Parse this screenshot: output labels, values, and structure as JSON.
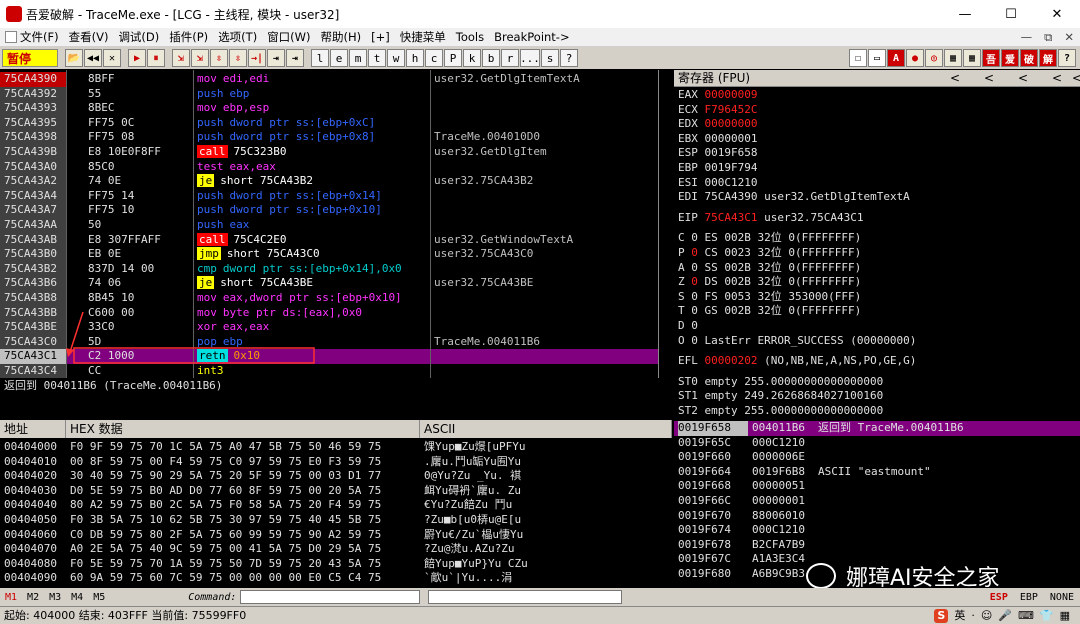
{
  "window": {
    "title": "吾爱破解 - TraceMe.exe - [LCG - 主线程, 模块 - user32]",
    "controls": {
      "min": "—",
      "max": "☐",
      "close": "✕"
    }
  },
  "menu": {
    "items": [
      "文件(F)",
      "查看(V)",
      "调试(D)",
      "插件(P)",
      "选项(T)",
      "窗口(W)",
      "帮助(H)",
      "[+]",
      "快捷菜单",
      "Tools",
      "BreakPoint->"
    ],
    "right": [
      "—",
      "⧉",
      "✕"
    ]
  },
  "toolbar": {
    "status": "暂停",
    "buttons": [
      "📂",
      "◀◀",
      "✕",
      "▶",
      "⏸",
      "⇲",
      "⇲",
      "⇳",
      "⇳",
      "→|",
      "⇥",
      "⇥"
    ],
    "letters": [
      "l",
      "e",
      "m",
      "t",
      "w",
      "h",
      "c",
      "P",
      "k",
      "b",
      "r",
      "...",
      "s",
      "?"
    ],
    "right_buttons": [
      "☐",
      "▭",
      "A",
      "●",
      "◎",
      "▦",
      "▦",
      "吾",
      "爱",
      "破",
      "解",
      "?"
    ]
  },
  "disasm": {
    "rows": [
      {
        "addr": "75CA4390",
        "hex": "8BFF",
        "op": "mov",
        "ops": "edi,edi",
        "cmt": "user32.GetDlgItemTextA",
        "cls": "kw-mov",
        "sel": true
      },
      {
        "addr": "75CA4392",
        "hex": "55",
        "op": "push",
        "ops": "ebp",
        "cmt": "",
        "cls": "kw-push"
      },
      {
        "addr": "75CA4393",
        "hex": "8BEC",
        "op": "mov",
        "ops": "ebp,esp",
        "cmt": "",
        "cls": "kw-mov"
      },
      {
        "addr": "75CA4395",
        "hex": "FF75 0C",
        "op": "push",
        "ops": "dword ptr ss:[ebp+0xC]",
        "cmt": "",
        "cls": "kw-push"
      },
      {
        "addr": "75CA4398",
        "hex": "FF75 08",
        "op": "push",
        "ops": "dword ptr ss:[ebp+0x8]",
        "cmt": "TraceMe.004010D0",
        "cls": "kw-push"
      },
      {
        "addr": "75CA439B",
        "hex": "E8 10E0F8FF",
        "op": "call",
        "ops": "75C323B0",
        "cmt": "user32.GetDlgItem",
        "cls": "kw-call"
      },
      {
        "addr": "75CA43A0",
        "hex": "85C0",
        "op": "test",
        "ops": "eax,eax",
        "cmt": "",
        "cls": "kw-test"
      },
      {
        "addr": "75CA43A2",
        "hex": "74 0E",
        "op": "je",
        "ops": "short 75CA43B2",
        "cmt": "user32.75CA43B2",
        "cls": "kw-je"
      },
      {
        "addr": "75CA43A4",
        "hex": "FF75 14",
        "op": "push",
        "ops": "dword ptr ss:[ebp+0x14]",
        "cmt": "",
        "cls": "kw-push"
      },
      {
        "addr": "75CA43A7",
        "hex": "FF75 10",
        "op": "push",
        "ops": "dword ptr ss:[ebp+0x10]",
        "cmt": "",
        "cls": "kw-push"
      },
      {
        "addr": "75CA43AA",
        "hex": "50",
        "op": "push",
        "ops": "eax",
        "cmt": "",
        "cls": "kw-push"
      },
      {
        "addr": "75CA43AB",
        "hex": "E8 307FFAFF",
        "op": "call",
        "ops": "75C4C2E0",
        "cmt": "user32.GetWindowTextA",
        "cls": "kw-call"
      },
      {
        "addr": "75CA43B0",
        "hex": "EB 0E",
        "op": "jmp",
        "ops": "short 75CA43C0",
        "cmt": "user32.75CA43C0",
        "cls": "kw-je"
      },
      {
        "addr": "75CA43B2",
        "hex": "837D 14 00",
        "op": "cmp",
        "ops": "dword ptr ss:[ebp+0x14],0x0",
        "cmt": "",
        "cls": "kw-cmp"
      },
      {
        "addr": "75CA43B6",
        "hex": "74 06",
        "op": "je",
        "ops": "short 75CA43BE",
        "cmt": "user32.75CA43BE",
        "cls": "kw-je"
      },
      {
        "addr": "75CA43B8",
        "hex": "8B45 10",
        "op": "mov",
        "ops": "eax,dword ptr ss:[ebp+0x10]",
        "cmt": "",
        "cls": "kw-mov"
      },
      {
        "addr": "75CA43BB",
        "hex": "C600 00",
        "op": "mov",
        "ops": "byte ptr ds:[eax],0x0",
        "cmt": "",
        "cls": "kw-mov"
      },
      {
        "addr": "75CA43BE",
        "hex": "33C0",
        "op": "xor",
        "ops": "eax,eax",
        "cmt": "",
        "cls": "kw-xor"
      },
      {
        "addr": "75CA43C0",
        "hex": "5D",
        "op": "pop",
        "ops": "ebp",
        "cmt": "TraceMe.004011B6",
        "cls": "kw-pop"
      },
      {
        "addr": "75CA43C1",
        "hex": "C2 1000",
        "op": "retn",
        "ops": "0x10",
        "cmt": "",
        "cls": "kw-retn",
        "hl": true
      },
      {
        "addr": "75CA43C4",
        "hex": "CC",
        "op": "int3",
        "ops": "",
        "cmt": "",
        "cls": "kw-int"
      }
    ],
    "info": "返回到 004011B6 (TraceMe.004011B6)"
  },
  "registers": {
    "header": "寄存器 (FPU)",
    "arrows": [
      "<",
      "<",
      "<",
      "<",
      "<"
    ],
    "gp": [
      {
        "name": "EAX",
        "val": "00000009",
        "red": true,
        "extra": ""
      },
      {
        "name": "ECX",
        "val": "F796452C",
        "red": true,
        "extra": ""
      },
      {
        "name": "EDX",
        "val": "00000000",
        "red": true,
        "extra": ""
      },
      {
        "name": "EBX",
        "val": "00000001",
        "red": false,
        "extra": ""
      },
      {
        "name": "ESP",
        "val": "0019F658",
        "red": false,
        "extra": ""
      },
      {
        "name": "EBP",
        "val": "0019F794",
        "red": false,
        "extra": ""
      },
      {
        "name": "ESI",
        "val": "000C1210",
        "red": false,
        "extra": ""
      },
      {
        "name": "EDI",
        "val": "75CA4390",
        "red": false,
        "extra": "user32.GetDlgItemTextA"
      }
    ],
    "eip": {
      "name": "EIP",
      "val": "75CA43C1",
      "extra": "user32.75CA43C1"
    },
    "flags": [
      {
        "f": "C",
        "v": "0",
        "seg": "ES",
        "sv": "002B",
        "bits": "32位",
        "lim": "0(FFFFFFFF)"
      },
      {
        "f": "P",
        "v": "0",
        "seg": "CS",
        "sv": "0023",
        "bits": "32位",
        "lim": "0(FFFFFFFF)",
        "red": true
      },
      {
        "f": "A",
        "v": "0",
        "seg": "SS",
        "sv": "002B",
        "bits": "32位",
        "lim": "0(FFFFFFFF)"
      },
      {
        "f": "Z",
        "v": "0",
        "seg": "DS",
        "sv": "002B",
        "bits": "32位",
        "lim": "0(FFFFFFFF)",
        "red": true
      },
      {
        "f": "S",
        "v": "0",
        "seg": "FS",
        "sv": "0053",
        "bits": "32位",
        "lim": "353000(FFF)"
      },
      {
        "f": "T",
        "v": "0",
        "seg": "GS",
        "sv": "002B",
        "bits": "32位",
        "lim": "0(FFFFFFFF)"
      },
      {
        "f": "D",
        "v": "0",
        "seg": "",
        "sv": "",
        "bits": "",
        "lim": ""
      },
      {
        "f": "O",
        "v": "0",
        "seg": "LastErr",
        "sv": "ERROR_SUCCESS (00000000)",
        "bits": "",
        "lim": ""
      }
    ],
    "efl": {
      "name": "EFL",
      "val": "00000202",
      "extra": "(NO,NB,NE,A,NS,PO,GE,G)"
    },
    "st": [
      "ST0 empty 255.00000000000000000",
      "ST1 empty 249.26268684027100160",
      "ST2 empty 255.00000000000000000"
    ]
  },
  "dump": {
    "headers": [
      "地址",
      "HEX 数据",
      "ASCII"
    ],
    "rows": [
      {
        "addr": "00404000",
        "hex": "F0 9F 59 75 70 1C 5A 75 A0 47 5B 75 50 46 59 75",
        "ascii": "馃Yup■Zu燝[uPFYu"
      },
      {
        "addr": "00404010",
        "hex": "00 8F 59 75 00 F4 59 75 C0 97 59 75 E0 F3 59 75",
        "ascii": ".廜u.鬥u缿Yu囿Yu"
      },
      {
        "addr": "00404020",
        "hex": "30 40 59 75 90 29 5A 75 20 5F 59 75 00 03 D1 77",
        "ascii": "0@Yu?Zu _Yu. 褀"
      },
      {
        "addr": "00404030",
        "hex": "D0 5E 59 75 B0 AD D0 77 60 8F 59 75 00 20 5A 75",
        "ascii": "衈Yu碍袇`廜u. Zu"
      },
      {
        "addr": "00404040",
        "hex": "80 A2 59 75 B0 2C 5A 75 F0 58 5A 75 20 F4 59 75",
        "ascii": "€Yu?Zu餢Zu 鬥u"
      },
      {
        "addr": "00404050",
        "hex": "F0 3B 5A 75 10 62 5B 75 30 97 59 75 40 45 5B 75",
        "ascii": "?Zu■b[u0梇u@E[u"
      },
      {
        "addr": "00404060",
        "hex": "C0 DB 59 75 80 2F 5A 75 60 99 59 75 90 A2 59 75",
        "ascii": "罻Yu€/Zu`橸u悽Yu"
      },
      {
        "addr": "00404070",
        "hex": "A0 2E 5A 75 40 9C 59 75 00 41 5A 75 D0 29 5A 75",
        "ascii": "?Zu@滼u.AZu?Zu"
      },
      {
        "addr": "00404080",
        "hex": "F0 5E 59 75 70 1A 59 75 50 7D 59 75 20 43 5A 75",
        "ascii": "餢Yup■YuP}Yu CZu"
      },
      {
        "addr": "00404090",
        "hex": "60 9A 59 75 60 7C 59 75 00 00 00 00 E0 C5 C4 75",
        "ascii": "`歒u`|Yu....涓"
      }
    ]
  },
  "stack": {
    "rows": [
      {
        "addr": "0019F658",
        "val": "004011B6",
        "cmt": "返回到 TraceMe.004011B6",
        "sel": true
      },
      {
        "addr": "0019F65C",
        "val": "000C1210",
        "cmt": ""
      },
      {
        "addr": "0019F660",
        "val": "0000006E",
        "cmt": ""
      },
      {
        "addr": "0019F664",
        "val": "0019F6B8",
        "cmt": "ASCII \"eastmount\""
      },
      {
        "addr": "0019F668",
        "val": "00000051",
        "cmt": ""
      },
      {
        "addr": "0019F66C",
        "val": "00000001",
        "cmt": ""
      },
      {
        "addr": "0019F670",
        "val": "88006010",
        "cmt": ""
      },
      {
        "addr": "0019F674",
        "val": "000C1210",
        "cmt": ""
      },
      {
        "addr": "0019F678",
        "val": "B2CFA7B9",
        "cmt": ""
      },
      {
        "addr": "0019F67C",
        "val": "A1A3E3C4",
        "cmt": ""
      },
      {
        "addr": "0019F680",
        "val": "A6B9C9B3",
        "cmt": ""
      }
    ]
  },
  "cmdbar": {
    "marks": [
      "M1",
      "M2",
      "M3",
      "M4",
      "M5"
    ],
    "label": "Command:",
    "right": [
      "ESP",
      "EBP",
      "NONE"
    ]
  },
  "statusbar": {
    "text": "起始: 404000 结束: 403FFF 当前值: 75599FF0",
    "ime": [
      "S",
      "英",
      "·",
      "☺",
      "🎤",
      "⌨",
      "👕",
      "▦"
    ]
  },
  "watermark": {
    "text": "娜璋AI安全之家"
  }
}
